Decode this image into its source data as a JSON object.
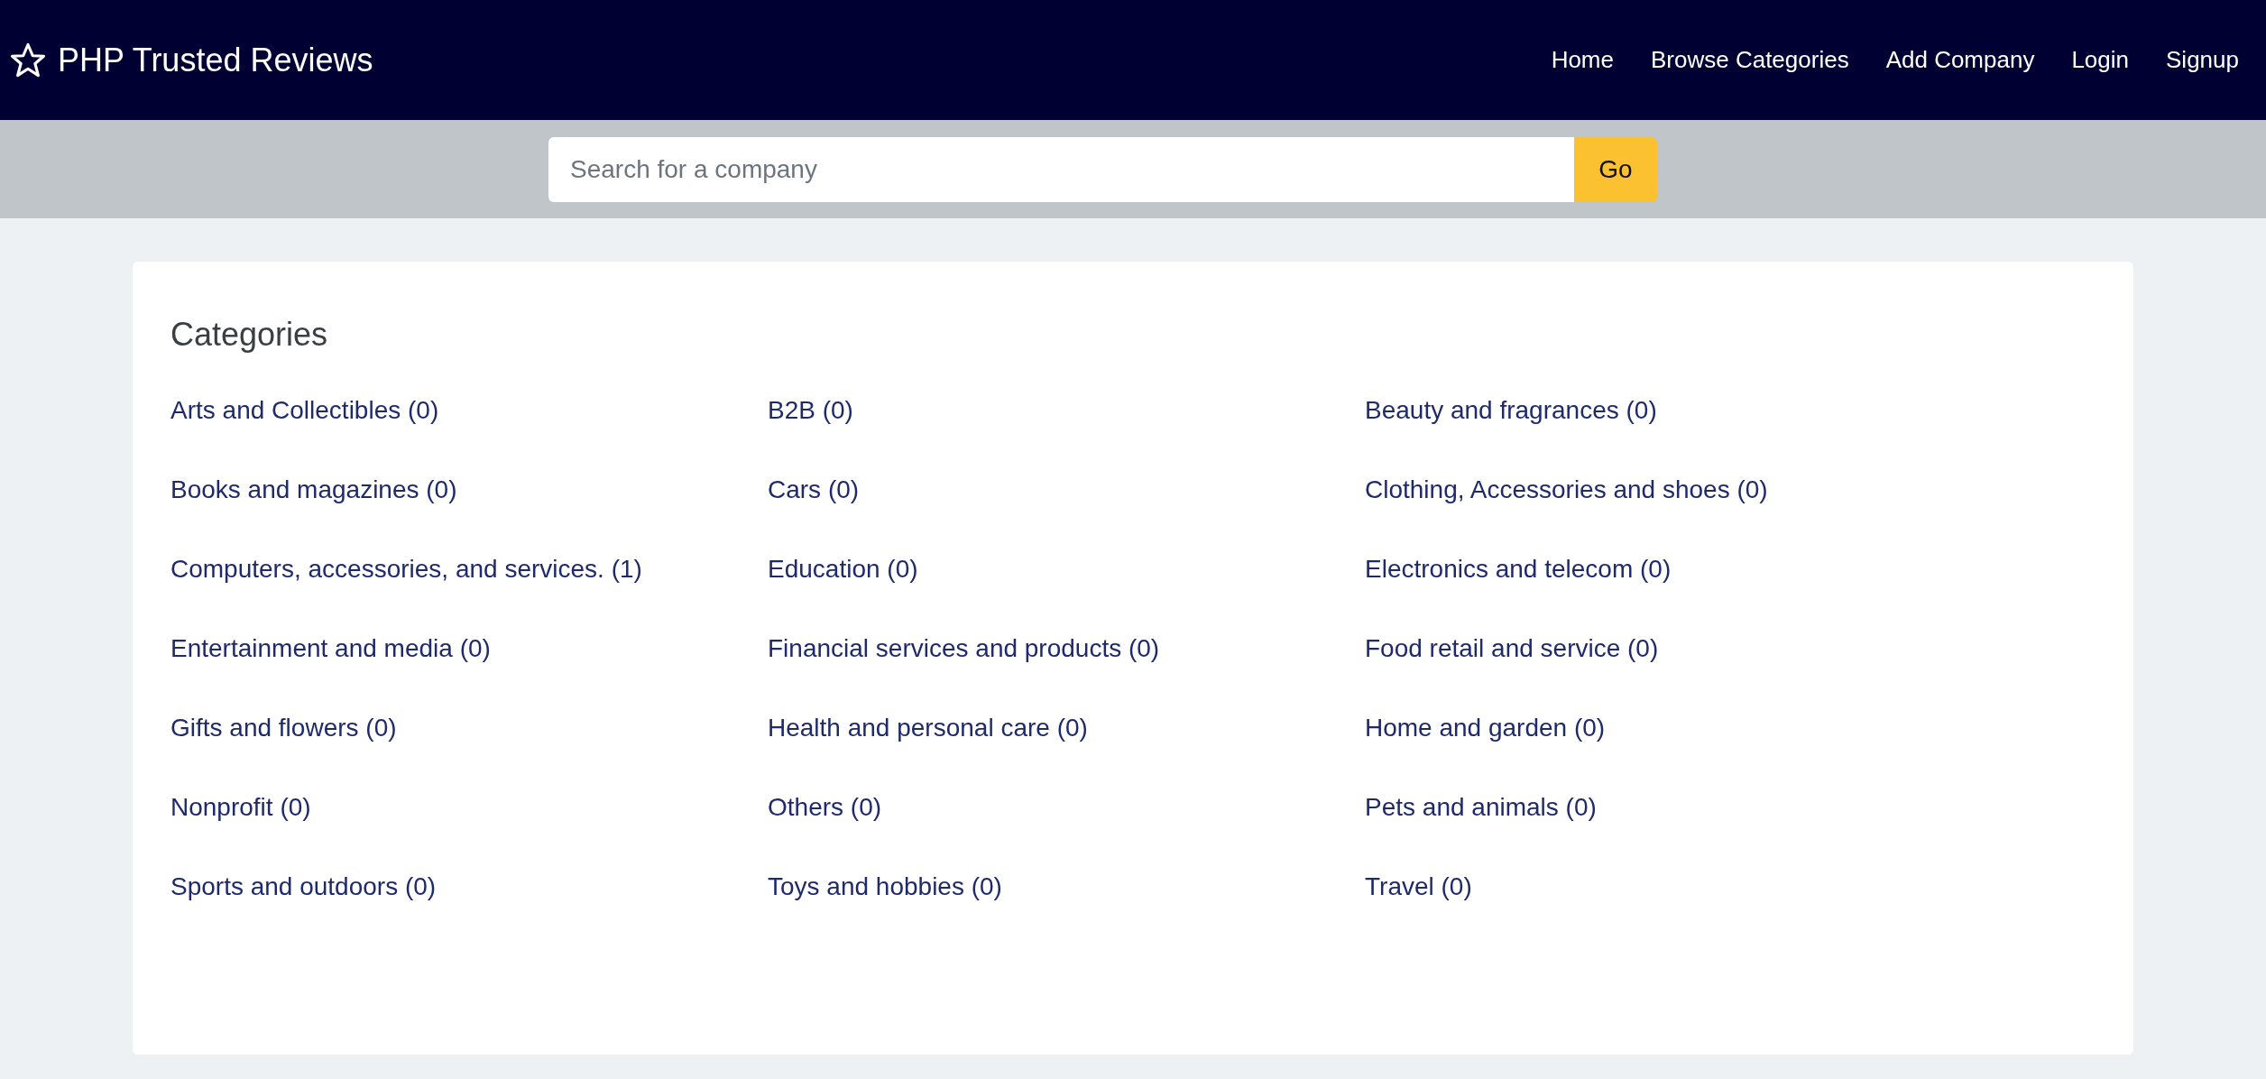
{
  "navbar": {
    "brand": "PHP Trusted Reviews",
    "links": [
      "Home",
      "Browse Categories",
      "Add Company",
      "Login",
      "Signup"
    ]
  },
  "search": {
    "placeholder": "Search for a company",
    "button": "Go"
  },
  "categories": {
    "title": "Categories",
    "items": [
      "Arts and Collectibles (0)",
      "B2B (0)",
      "Beauty and fragrances (0)",
      "Books and magazines (0)",
      "Cars (0)",
      "Clothing, Accessories and shoes (0)",
      "Computers, accessories, and services. (1)",
      "Education (0)",
      "Electronics and telecom (0)",
      "Entertainment and media (0)",
      "Financial services and products (0)",
      "Food retail and service (0)",
      "Gifts and flowers (0)",
      "Health and personal care (0)",
      "Home and garden (0)",
      "Nonprofit (0)",
      "Others (0)",
      "Pets and animals (0)",
      "Sports and outdoors (0)",
      "Toys and hobbies (0)",
      "Travel (0)"
    ]
  }
}
